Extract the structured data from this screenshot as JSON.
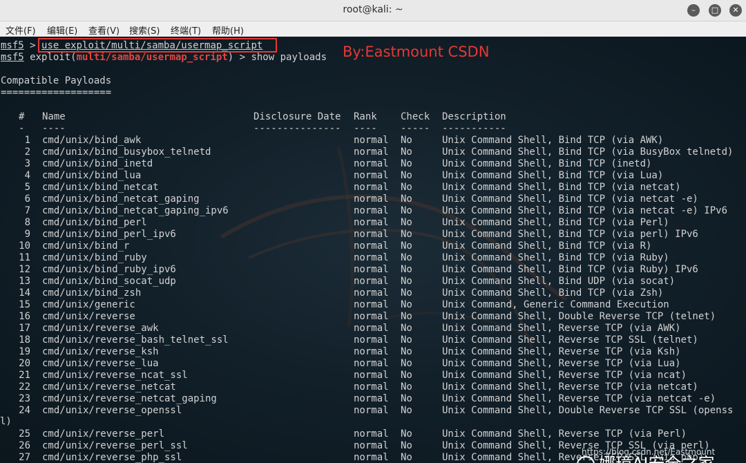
{
  "window": {
    "title": "root@kali: ~",
    "minimize_icon": "minimize-icon",
    "maximize_icon": "maximize-icon",
    "close_icon": "close-icon"
  },
  "menu": [
    {
      "label": "文件(F)"
    },
    {
      "label": "编辑(E)"
    },
    {
      "label": "查看(V)"
    },
    {
      "label": "搜索(S)"
    },
    {
      "label": "终端(T)"
    },
    {
      "label": "帮助(H)"
    }
  ],
  "terminal": {
    "prompt": "msf5",
    "line1_rest": " > ",
    "line1_cmd": "use exploit/multi/samba/usermap_script",
    "line2_pre": " exploit(",
    "line2_module": "multi/samba/usermap_script",
    "line2_post": ") > show payloads",
    "watermark": "By:Eastmount CSDN",
    "section_title": "Compatible Payloads",
    "section_rule": "===================",
    "headers": {
      "num": "#",
      "name": "Name",
      "date": "Disclosure Date",
      "rank": "Rank",
      "check": "Check",
      "desc": "Description"
    },
    "dashes": {
      "num": "-",
      "name": "----",
      "date": "---------------",
      "rank": "----",
      "check": "-----",
      "desc": "-----------"
    },
    "rows": [
      {
        "num": "1",
        "name": "cmd/unix/bind_awk",
        "rank": "normal",
        "check": "No",
        "desc": "Unix Command Shell, Bind TCP (via AWK)"
      },
      {
        "num": "2",
        "name": "cmd/unix/bind_busybox_telnetd",
        "rank": "normal",
        "check": "No",
        "desc": "Unix Command Shell, Bind TCP (via BusyBox telnetd)"
      },
      {
        "num": "3",
        "name": "cmd/unix/bind_inetd",
        "rank": "normal",
        "check": "No",
        "desc": "Unix Command Shell, Bind TCP (inetd)"
      },
      {
        "num": "4",
        "name": "cmd/unix/bind_lua",
        "rank": "normal",
        "check": "No",
        "desc": "Unix Command Shell, Bind TCP (via Lua)"
      },
      {
        "num": "5",
        "name": "cmd/unix/bind_netcat",
        "rank": "normal",
        "check": "No",
        "desc": "Unix Command Shell, Bind TCP (via netcat)"
      },
      {
        "num": "6",
        "name": "cmd/unix/bind_netcat_gaping",
        "rank": "normal",
        "check": "No",
        "desc": "Unix Command Shell, Bind TCP (via netcat -e)"
      },
      {
        "num": "7",
        "name": "cmd/unix/bind_netcat_gaping_ipv6",
        "rank": "normal",
        "check": "No",
        "desc": "Unix Command Shell, Bind TCP (via netcat -e) IPv6"
      },
      {
        "num": "8",
        "name": "cmd/unix/bind_perl",
        "rank": "normal",
        "check": "No",
        "desc": "Unix Command Shell, Bind TCP (via Perl)"
      },
      {
        "num": "9",
        "name": "cmd/unix/bind_perl_ipv6",
        "rank": "normal",
        "check": "No",
        "desc": "Unix Command Shell, Bind TCP (via perl) IPv6"
      },
      {
        "num": "10",
        "name": "cmd/unix/bind_r",
        "rank": "normal",
        "check": "No",
        "desc": "Unix Command Shell, Bind TCP (via R)"
      },
      {
        "num": "11",
        "name": "cmd/unix/bind_ruby",
        "rank": "normal",
        "check": "No",
        "desc": "Unix Command Shell, Bind TCP (via Ruby)"
      },
      {
        "num": "12",
        "name": "cmd/unix/bind_ruby_ipv6",
        "rank": "normal",
        "check": "No",
        "desc": "Unix Command Shell, Bind TCP (via Ruby) IPv6"
      },
      {
        "num": "13",
        "name": "cmd/unix/bind_socat_udp",
        "rank": "normal",
        "check": "No",
        "desc": "Unix Command Shell, Bind UDP (via socat)"
      },
      {
        "num": "14",
        "name": "cmd/unix/bind_zsh",
        "rank": "normal",
        "check": "No",
        "desc": "Unix Command Shell, Bind TCP (via Zsh)"
      },
      {
        "num": "15",
        "name": "cmd/unix/generic",
        "rank": "normal",
        "check": "No",
        "desc": "Unix Command, Generic Command Execution"
      },
      {
        "num": "16",
        "name": "cmd/unix/reverse",
        "rank": "normal",
        "check": "No",
        "desc": "Unix Command Shell, Double Reverse TCP (telnet)"
      },
      {
        "num": "17",
        "name": "cmd/unix/reverse_awk",
        "rank": "normal",
        "check": "No",
        "desc": "Unix Command Shell, Reverse TCP (via AWK)"
      },
      {
        "num": "18",
        "name": "cmd/unix/reverse_bash_telnet_ssl",
        "rank": "normal",
        "check": "No",
        "desc": "Unix Command Shell, Reverse TCP SSL (telnet)"
      },
      {
        "num": "19",
        "name": "cmd/unix/reverse_ksh",
        "rank": "normal",
        "check": "No",
        "desc": "Unix Command Shell, Reverse TCP (via Ksh)"
      },
      {
        "num": "20",
        "name": "cmd/unix/reverse_lua",
        "rank": "normal",
        "check": "No",
        "desc": "Unix Command Shell, Reverse TCP (via Lua)"
      },
      {
        "num": "21",
        "name": "cmd/unix/reverse_ncat_ssl",
        "rank": "normal",
        "check": "No",
        "desc": "Unix Command Shell, Reverse TCP (via ncat)"
      },
      {
        "num": "22",
        "name": "cmd/unix/reverse_netcat",
        "rank": "normal",
        "check": "No",
        "desc": "Unix Command Shell, Reverse TCP (via netcat)"
      },
      {
        "num": "23",
        "name": "cmd/unix/reverse_netcat_gaping",
        "rank": "normal",
        "check": "No",
        "desc": "Unix Command Shell, Reverse TCP (via netcat -e)"
      },
      {
        "num": "24",
        "name": "cmd/unix/reverse_openssl",
        "rank": "normal",
        "check": "No",
        "desc": "Unix Command Shell, Double Reverse TCP SSL (openss"
      },
      {
        "num": "25",
        "name": "cmd/unix/reverse_perl",
        "rank": "normal",
        "check": "No",
        "desc": "Unix Command Shell, Reverse TCP (via Perl)"
      },
      {
        "num": "26",
        "name": "cmd/unix/reverse_perl_ssl",
        "rank": "normal",
        "check": "No",
        "desc": "Unix Command Shell, Reverse TCP SSL (via perl)"
      },
      {
        "num": "27",
        "name": "cmd/unix/reverse_php_ssl",
        "rank": "normal",
        "check": "No",
        "desc": "Unix Command Shell, Reverse TCP SSL (via php)"
      }
    ],
    "wrap_text": "l)"
  },
  "overlay": {
    "wechat_text": "娜璋AI安全之家",
    "url_text": "https://blog.csdn.net/Eastmount",
    "wechat_icon": "wechat-icon"
  }
}
